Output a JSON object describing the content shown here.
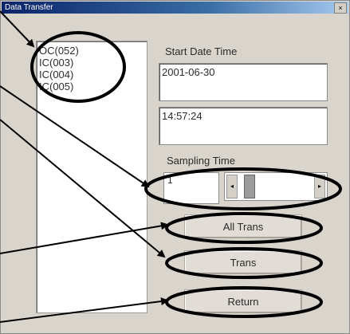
{
  "window": {
    "title": "Data Transfer",
    "close_glyph": "×"
  },
  "list": {
    "items": [
      "OC(052)",
      "IC(003)",
      "IC(004)",
      "IC(005)"
    ]
  },
  "start": {
    "label": "Start Date Time",
    "date": "2001-06-30",
    "time": "14:57:24"
  },
  "sampling": {
    "label": "Sampling Time",
    "value": "1"
  },
  "buttons": {
    "all_trans": "All Trans",
    "trans": "Trans",
    "return": "Return"
  },
  "icons": {
    "close": "close-icon",
    "left_arrow": "left-arrow-icon",
    "right_arrow": "right-arrow-icon"
  }
}
